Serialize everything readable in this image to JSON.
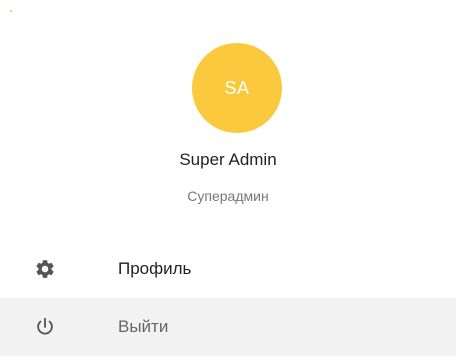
{
  "user": {
    "initials": "SA",
    "name": "Super Admin",
    "role": "Суперадмин",
    "avatar_color": "#fbc93d"
  },
  "menu": {
    "items": [
      {
        "label": "Профиль",
        "icon": "gear-icon"
      },
      {
        "label": "Выйти",
        "icon": "power-icon",
        "highlighted": true
      }
    ]
  },
  "colors": {
    "hover_background": "#f2f2f2",
    "icon_color": "#555555"
  }
}
